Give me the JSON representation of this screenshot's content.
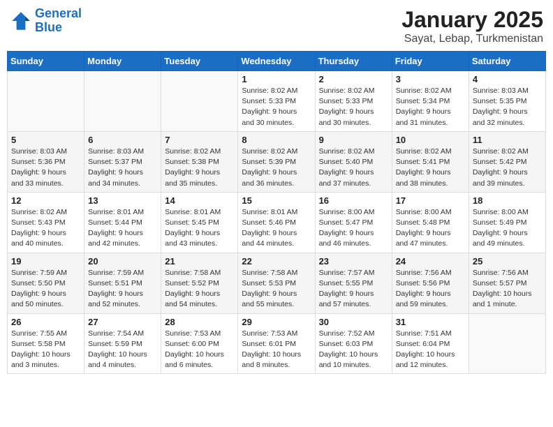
{
  "header": {
    "logo_line1": "General",
    "logo_line2": "Blue",
    "title": "January 2025",
    "subtitle": "Sayat, Lebap, Turkmenistan"
  },
  "weekdays": [
    "Sunday",
    "Monday",
    "Tuesday",
    "Wednesday",
    "Thursday",
    "Friday",
    "Saturday"
  ],
  "weeks": [
    [
      {
        "day": "",
        "info": ""
      },
      {
        "day": "",
        "info": ""
      },
      {
        "day": "",
        "info": ""
      },
      {
        "day": "1",
        "info": "Sunrise: 8:02 AM\nSunset: 5:33 PM\nDaylight: 9 hours\nand 30 minutes."
      },
      {
        "day": "2",
        "info": "Sunrise: 8:02 AM\nSunset: 5:33 PM\nDaylight: 9 hours\nand 30 minutes."
      },
      {
        "day": "3",
        "info": "Sunrise: 8:02 AM\nSunset: 5:34 PM\nDaylight: 9 hours\nand 31 minutes."
      },
      {
        "day": "4",
        "info": "Sunrise: 8:03 AM\nSunset: 5:35 PM\nDaylight: 9 hours\nand 32 minutes."
      }
    ],
    [
      {
        "day": "5",
        "info": "Sunrise: 8:03 AM\nSunset: 5:36 PM\nDaylight: 9 hours\nand 33 minutes."
      },
      {
        "day": "6",
        "info": "Sunrise: 8:03 AM\nSunset: 5:37 PM\nDaylight: 9 hours\nand 34 minutes."
      },
      {
        "day": "7",
        "info": "Sunrise: 8:02 AM\nSunset: 5:38 PM\nDaylight: 9 hours\nand 35 minutes."
      },
      {
        "day": "8",
        "info": "Sunrise: 8:02 AM\nSunset: 5:39 PM\nDaylight: 9 hours\nand 36 minutes."
      },
      {
        "day": "9",
        "info": "Sunrise: 8:02 AM\nSunset: 5:40 PM\nDaylight: 9 hours\nand 37 minutes."
      },
      {
        "day": "10",
        "info": "Sunrise: 8:02 AM\nSunset: 5:41 PM\nDaylight: 9 hours\nand 38 minutes."
      },
      {
        "day": "11",
        "info": "Sunrise: 8:02 AM\nSunset: 5:42 PM\nDaylight: 9 hours\nand 39 minutes."
      }
    ],
    [
      {
        "day": "12",
        "info": "Sunrise: 8:02 AM\nSunset: 5:43 PM\nDaylight: 9 hours\nand 40 minutes."
      },
      {
        "day": "13",
        "info": "Sunrise: 8:01 AM\nSunset: 5:44 PM\nDaylight: 9 hours\nand 42 minutes."
      },
      {
        "day": "14",
        "info": "Sunrise: 8:01 AM\nSunset: 5:45 PM\nDaylight: 9 hours\nand 43 minutes."
      },
      {
        "day": "15",
        "info": "Sunrise: 8:01 AM\nSunset: 5:46 PM\nDaylight: 9 hours\nand 44 minutes."
      },
      {
        "day": "16",
        "info": "Sunrise: 8:00 AM\nSunset: 5:47 PM\nDaylight: 9 hours\nand 46 minutes."
      },
      {
        "day": "17",
        "info": "Sunrise: 8:00 AM\nSunset: 5:48 PM\nDaylight: 9 hours\nand 47 minutes."
      },
      {
        "day": "18",
        "info": "Sunrise: 8:00 AM\nSunset: 5:49 PM\nDaylight: 9 hours\nand 49 minutes."
      }
    ],
    [
      {
        "day": "19",
        "info": "Sunrise: 7:59 AM\nSunset: 5:50 PM\nDaylight: 9 hours\nand 50 minutes."
      },
      {
        "day": "20",
        "info": "Sunrise: 7:59 AM\nSunset: 5:51 PM\nDaylight: 9 hours\nand 52 minutes."
      },
      {
        "day": "21",
        "info": "Sunrise: 7:58 AM\nSunset: 5:52 PM\nDaylight: 9 hours\nand 54 minutes."
      },
      {
        "day": "22",
        "info": "Sunrise: 7:58 AM\nSunset: 5:53 PM\nDaylight: 9 hours\nand 55 minutes."
      },
      {
        "day": "23",
        "info": "Sunrise: 7:57 AM\nSunset: 5:55 PM\nDaylight: 9 hours\nand 57 minutes."
      },
      {
        "day": "24",
        "info": "Sunrise: 7:56 AM\nSunset: 5:56 PM\nDaylight: 9 hours\nand 59 minutes."
      },
      {
        "day": "25",
        "info": "Sunrise: 7:56 AM\nSunset: 5:57 PM\nDaylight: 10 hours\nand 1 minute."
      }
    ],
    [
      {
        "day": "26",
        "info": "Sunrise: 7:55 AM\nSunset: 5:58 PM\nDaylight: 10 hours\nand 3 minutes."
      },
      {
        "day": "27",
        "info": "Sunrise: 7:54 AM\nSunset: 5:59 PM\nDaylight: 10 hours\nand 4 minutes."
      },
      {
        "day": "28",
        "info": "Sunrise: 7:53 AM\nSunset: 6:00 PM\nDaylight: 10 hours\nand 6 minutes."
      },
      {
        "day": "29",
        "info": "Sunrise: 7:53 AM\nSunset: 6:01 PM\nDaylight: 10 hours\nand 8 minutes."
      },
      {
        "day": "30",
        "info": "Sunrise: 7:52 AM\nSunset: 6:03 PM\nDaylight: 10 hours\nand 10 minutes."
      },
      {
        "day": "31",
        "info": "Sunrise: 7:51 AM\nSunset: 6:04 PM\nDaylight: 10 hours\nand 12 minutes."
      },
      {
        "day": "",
        "info": ""
      }
    ]
  ]
}
